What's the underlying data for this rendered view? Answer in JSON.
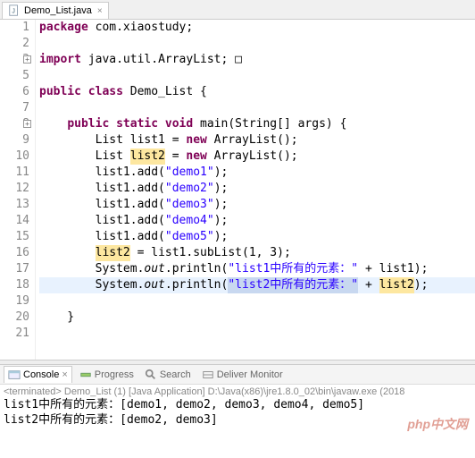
{
  "editor_tab": {
    "icon": "java-file-icon",
    "label": "Demo_List.java",
    "close": "×"
  },
  "code": {
    "lines": [
      {
        "n": "1",
        "tokens": [
          {
            "t": "package ",
            "c": "kw"
          },
          {
            "t": "com.xiaostudy;",
            "c": ""
          }
        ]
      },
      {
        "n": "2",
        "tokens": []
      },
      {
        "n": "3",
        "expand": true,
        "tokens": [
          {
            "t": "import ",
            "c": "kw"
          },
          {
            "t": "java.util.ArrayList;",
            "c": ""
          },
          {
            "t": " □",
            "c": ""
          }
        ]
      },
      {
        "n": "5",
        "tokens": []
      },
      {
        "n": "6",
        "tokens": [
          {
            "t": "public class ",
            "c": "kw"
          },
          {
            "t": "Demo_List {",
            "c": ""
          }
        ]
      },
      {
        "n": "7",
        "tokens": []
      },
      {
        "n": "8",
        "expand": true,
        "tokens": [
          {
            "t": "    ",
            "c": ""
          },
          {
            "t": "public static void ",
            "c": "kw"
          },
          {
            "t": "main(String[] args) {",
            "c": ""
          }
        ]
      },
      {
        "n": "9",
        "tokens": [
          {
            "t": "        List list1 = ",
            "c": ""
          },
          {
            "t": "new",
            "c": "kw"
          },
          {
            "t": " ArrayList();",
            "c": ""
          }
        ]
      },
      {
        "n": "10",
        "tokens": [
          {
            "t": "        List ",
            "c": ""
          },
          {
            "t": "list2",
            "c": "hl"
          },
          {
            "t": " = ",
            "c": ""
          },
          {
            "t": "new",
            "c": "kw"
          },
          {
            "t": " ArrayList();",
            "c": ""
          }
        ]
      },
      {
        "n": "11",
        "tokens": [
          {
            "t": "        list1.add(",
            "c": ""
          },
          {
            "t": "\"demo1\"",
            "c": "str"
          },
          {
            "t": ");",
            "c": ""
          }
        ]
      },
      {
        "n": "12",
        "tokens": [
          {
            "t": "        list1.add(",
            "c": ""
          },
          {
            "t": "\"demo2\"",
            "c": "str"
          },
          {
            "t": ");",
            "c": ""
          }
        ]
      },
      {
        "n": "13",
        "tokens": [
          {
            "t": "        list1.add(",
            "c": ""
          },
          {
            "t": "\"demo3\"",
            "c": "str"
          },
          {
            "t": ");",
            "c": ""
          }
        ]
      },
      {
        "n": "14",
        "tokens": [
          {
            "t": "        list1.add(",
            "c": ""
          },
          {
            "t": "\"demo4\"",
            "c": "str"
          },
          {
            "t": ");",
            "c": ""
          }
        ]
      },
      {
        "n": "15",
        "tokens": [
          {
            "t": "        list1.add(",
            "c": ""
          },
          {
            "t": "\"demo5\"",
            "c": "str"
          },
          {
            "t": ");",
            "c": ""
          }
        ]
      },
      {
        "n": "16",
        "tokens": [
          {
            "t": "        ",
            "c": ""
          },
          {
            "t": "list2",
            "c": "hl"
          },
          {
            "t": " = list1.subList(1, 3);",
            "c": ""
          }
        ]
      },
      {
        "n": "17",
        "tokens": [
          {
            "t": "        System.",
            "c": ""
          },
          {
            "t": "out",
            "c": "it"
          },
          {
            "t": ".println(",
            "c": ""
          },
          {
            "t": "\"list1中所有的元素：\"",
            "c": "str"
          },
          {
            "t": " + list1);",
            "c": ""
          }
        ]
      },
      {
        "n": "18",
        "current": true,
        "tokens": [
          {
            "t": "        System.",
            "c": ""
          },
          {
            "t": "out",
            "c": "it"
          },
          {
            "t": ".println(",
            "c": ""
          },
          {
            "t": "\"list2中所有的元素：\"",
            "c": "str sel"
          },
          {
            "t": " + ",
            "c": ""
          },
          {
            "t": "list2",
            "c": "hl"
          },
          {
            "t": ");",
            "c": ""
          }
        ]
      },
      {
        "n": "19",
        "tokens": []
      },
      {
        "n": "20",
        "tokens": [
          {
            "t": "    }",
            "c": ""
          }
        ]
      },
      {
        "n": "21",
        "tokens": []
      }
    ]
  },
  "console": {
    "tabs": [
      {
        "icon": "console-icon",
        "label": "Console",
        "active": true,
        "close": "×"
      },
      {
        "icon": "progress-icon",
        "label": "Progress"
      },
      {
        "icon": "search-icon",
        "label": "Search"
      },
      {
        "icon": "deliver-icon",
        "label": "Deliver Monitor"
      }
    ],
    "terminated": "<terminated> Demo_List (1) [Java Application] D:\\Java(x86)\\jre1.8.0_02\\bin\\javaw.exe (2018",
    "output": [
      "list1中所有的元素：[demo1, demo2, demo3, demo4, demo5]",
      "list2中所有的元素：[demo2, demo3]"
    ]
  },
  "watermark": "php中文网"
}
